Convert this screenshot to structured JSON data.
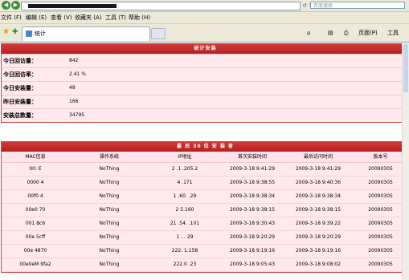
{
  "browser": {
    "address_redacted": "•••••••••••••",
    "search_placeholder": "百度搜索",
    "menu": [
      "文件 (F)",
      "编辑 (E)",
      "查看 (V)",
      "收藏夹 (A)",
      "工具 (T)",
      "帮助 (H)"
    ],
    "tab_label": "统计",
    "tools": {
      "page": "页面(P)",
      "tools": "工具"
    }
  },
  "stats": {
    "title": "统计安装",
    "rows": [
      {
        "label": "今日回访量：",
        "value": "842"
      },
      {
        "label": "今日回访率：",
        "value": "2.41 %"
      },
      {
        "label": "今日安装量：",
        "value": "48"
      },
      {
        "label": "昨日安装量：",
        "value": "166"
      },
      {
        "label": "安装总数量：",
        "value": "34795"
      }
    ]
  },
  "recent": {
    "title": "最 后 30 位 安 装 者",
    "headers": [
      "MAC信息",
      "操作系统",
      "IP地址",
      "首次安装时间",
      "最后访问时间",
      "版本号"
    ],
    "rows": [
      [
        "00:  E",
        "NoThing",
        "2  .1  .205.2",
        "2009-3-18 9:41:29",
        "2009-3-18 9:41:29",
        "20090305"
      ],
      [
        "0000  4",
        "NoThing",
        "4    .171",
        "2009-3-18 9:38:55",
        "2009-3-18 9:40:36",
        "20090305"
      ],
      [
        "00f0  4",
        "NoThing",
        "1  .60.  .29",
        "2009-3-18 9:38:34",
        "2009-3-18 9:38:34",
        "20090305"
      ],
      [
        "00e0  70",
        "NoThing",
        "2    5.160",
        "2009-3-18 9:38:15",
        "2009-3-18 9:38:15",
        "20090305"
      ],
      [
        "001  8c6",
        "NoThing",
        "21  .54.  .101",
        "2009-3-18 9:30:43",
        "2009-3-18 9:39:22",
        "20090305"
      ],
      [
        "00e  5cff",
        "NoThing",
        "1  .  .  29",
        "2009-3-18 9:20:29",
        "2009-3-18 9:20:29",
        "20090305"
      ],
      [
        "00e  4870",
        "NoThing",
        "222.  1.158",
        "2009-3-18 9:19:16",
        "2009-3-18 9:19:16",
        "20090305"
      ],
      [
        "00e0eM  9fa2",
        "NoThing",
        "222.0  .23",
        "2009-3-18 9:05:43",
        "2009-3-18 9:08:02",
        "20090305"
      ]
    ]
  },
  "colors": {
    "accent": "#c0282d",
    "panel_bg": "#ffe9ec",
    "chrome": "#ece9d8"
  }
}
